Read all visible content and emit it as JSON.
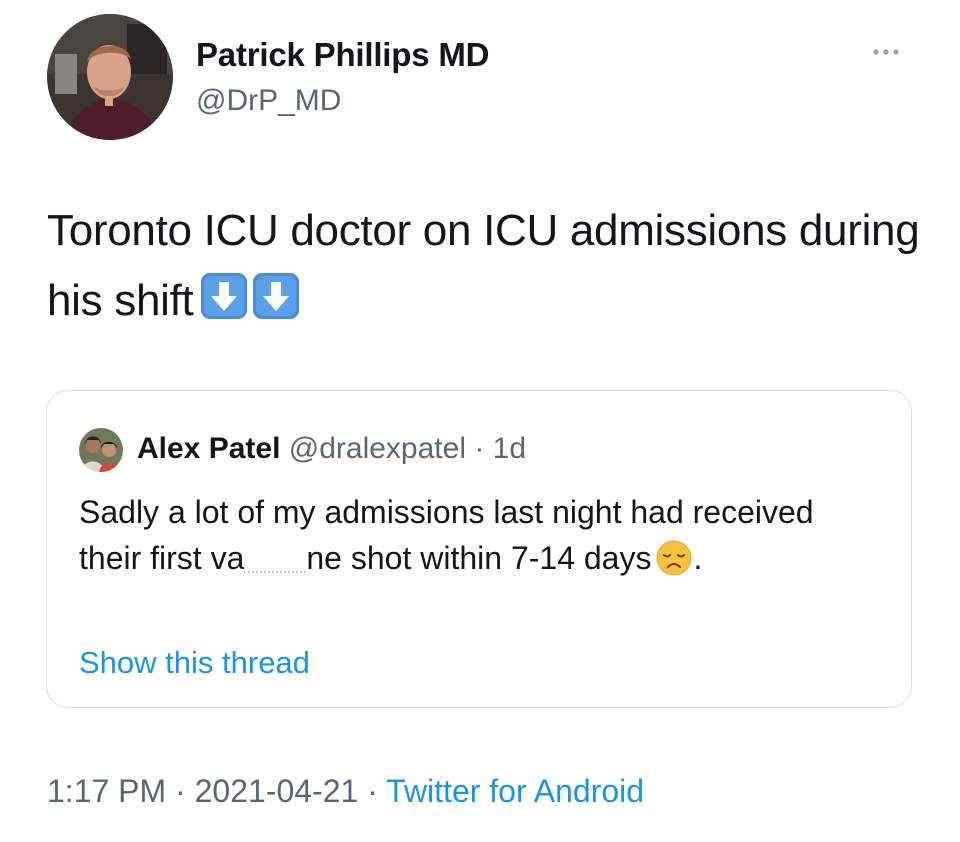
{
  "author": {
    "display_name": "Patrick Phillips MD",
    "handle": "@DrP_MD",
    "avatar_icon": "profile-photo"
  },
  "more_icon": "ellipsis-icon",
  "tweet": {
    "text": "Toronto ICU doctor on ICU admissions during his shift",
    "emojis": [
      "down-arrow-emoji",
      "down-arrow-emoji"
    ]
  },
  "quote": {
    "name": "Alex Patel",
    "handle": "@dralexpatel",
    "separator": " · ",
    "age": "1d",
    "text_part1": "Sadly a lot of my admissions last night had received their first va",
    "text_part2": "ne shot  within 7-14 days",
    "text_end": ".",
    "emoji": "disappointed-face-emoji",
    "show_thread": "Show this thread"
  },
  "footer": {
    "time": "1:17 PM",
    "separator": " · ",
    "date": "2021-04-21",
    "source": "Twitter for Android"
  },
  "colors": {
    "text": "#14171a",
    "secondary": "#5b6770",
    "link": "#1b95e0",
    "border": "#d7dde2"
  }
}
